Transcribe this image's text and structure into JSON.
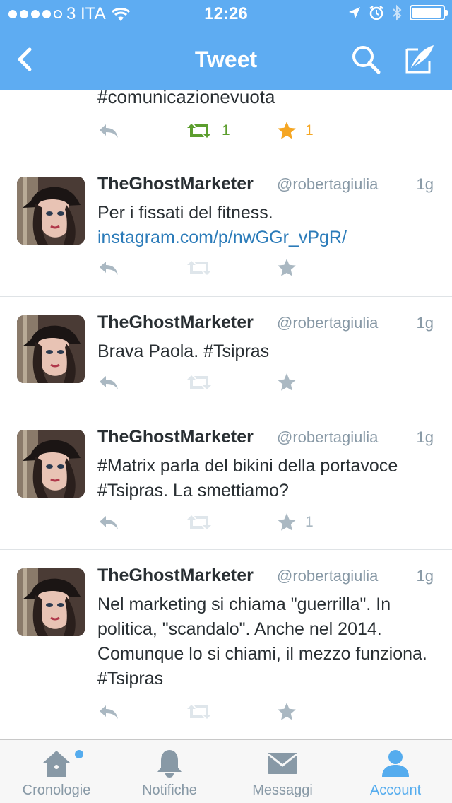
{
  "status_bar": {
    "carrier": "3 ITA",
    "time": "12:26",
    "signal_icon": "signal-dots-icon",
    "wifi_icon": "wifi-icon",
    "location_icon": "location-arrow-icon",
    "alarm_icon": "alarm-icon",
    "bluetooth_icon": "bluetooth-icon",
    "battery_icon": "battery-icon"
  },
  "header": {
    "title": "Tweet",
    "back_icon": "chevron-left-icon",
    "search_icon": "search-icon",
    "compose_icon": "compose-quill-icon",
    "color": "#5eacf2"
  },
  "partial_tweet": {
    "text": "#comunicazionevuota",
    "retweets": "1",
    "favorites": "1"
  },
  "tweets": [
    {
      "name": "TheGhostMarketer",
      "handle": "@robertagiulia",
      "time": "1g",
      "text": "Per i fissati del fitness.",
      "link": "instagram.com/p/nwGGr_vPgR/",
      "favorites": ""
    },
    {
      "name": "TheGhostMarketer",
      "handle": "@robertagiulia",
      "time": "1g",
      "text": "Brava Paola. #Tsipras",
      "favorites": ""
    },
    {
      "name": "TheGhostMarketer",
      "handle": "@robertagiulia",
      "time": "1g",
      "text": "#Matrix parla del bikini della portavoce #Tsipras. La smettiamo?",
      "favorites": "1"
    },
    {
      "name": "TheGhostMarketer",
      "handle": "@robertagiulia",
      "time": "1g",
      "text": "Nel marketing si chiama \"guerrilla\". In politica, \"scandalo\". Anche nel 2014. Comunque lo si chiami, il mezzo funziona. #Tsipras",
      "favorites": ""
    }
  ],
  "tabs": [
    {
      "label": "Cronologie",
      "icon": "home-icon",
      "active": false,
      "badge": true
    },
    {
      "label": "Notifiche",
      "icon": "bell-icon",
      "active": false
    },
    {
      "label": "Messaggi",
      "icon": "envelope-icon",
      "active": false
    },
    {
      "label": "Account",
      "icon": "person-icon",
      "active": true
    }
  ],
  "colors": {
    "accent": "#55acee",
    "retweet_active": "#5c9e2e",
    "favorite_active": "#f5a623",
    "action_inactive": "#aab8c2",
    "link": "#2b7bb9"
  }
}
